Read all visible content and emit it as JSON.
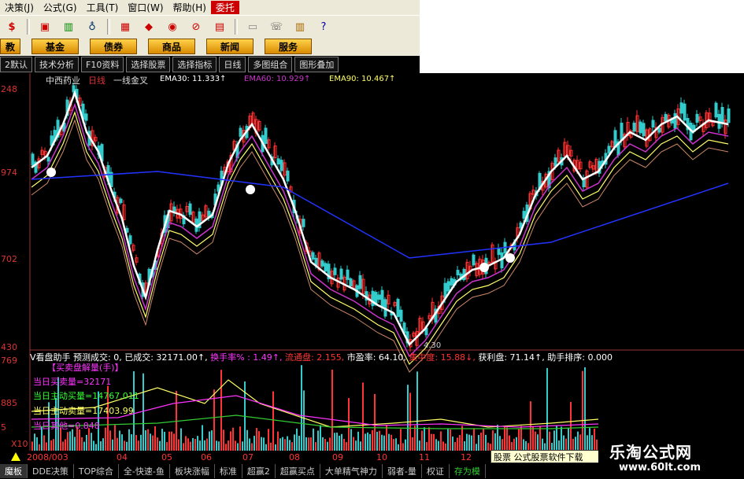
{
  "menu": {
    "items": [
      "决策(J)",
      "公式(G)",
      "工具(T)",
      "窗口(W)",
      "帮助(H)",
      "委托"
    ]
  },
  "nav": {
    "buttons": [
      "教",
      "基金",
      "债券",
      "商品",
      "新闻",
      "服务"
    ]
  },
  "toolbar2": {
    "items": [
      "2默认",
      "技术分析",
      "F10资料",
      "选择股票",
      "选择指标",
      "日线",
      "多图组合",
      "图形叠加"
    ]
  },
  "chart_header": {
    "stock": "中西药业",
    "period": "日线",
    "pattern": "一线金叉",
    "ema30": "EMA30: 11.333↑",
    "ema60": "EMA60: 10.929↑",
    "ema90": "EMA90: 10.467↑"
  },
  "yaxis": {
    "top": "248",
    "mid1": "974",
    "mid2": "702",
    "bottom": "430"
  },
  "low_marker": "4.30",
  "info_bar": {
    "title": "V看盘助手",
    "forecast": "预测成交: 0,",
    "done": "已成交: 32171.00↑,",
    "turnover": "换手率% : 1.49↑,",
    "float": "流通盘: 2.155,",
    "pe": "市盈率: 64.10,",
    "focus": "集中度: 15.88↓,",
    "profit": "获利盘: 71.14↑,",
    "rank": "助手排序: 0.000"
  },
  "volume_panel": {
    "ylabel_top": "769",
    "ylabel_mid": "885",
    "ylabel_bottom": "5",
    "title": "【买卖盘解量(手)】",
    "today_vol": "当日买卖量=32171",
    "active_buy": "当日主动买量=14767.011",
    "active_sell": "当日主动卖量=17403.99",
    "other": "当日其他=0.848",
    "xlabel_prefix": "X10"
  },
  "dates": [
    "2008/003",
    "04",
    "05",
    "06",
    "07",
    "08",
    "09",
    "10",
    "11",
    "12"
  ],
  "bottom_tabs": [
    "魔板",
    "DDE决策",
    "TOP综合",
    "全-快速-鱼",
    "板块涨幅",
    "标准",
    "超赢2",
    "超赢买点",
    "大单精气神力",
    "弱者-量",
    "权证",
    "存为模"
  ],
  "tooltip": "股票 公式股票软件下载",
  "brand": {
    "title": "乐淘公式网",
    "url": "www.60lt.com"
  },
  "colors": {
    "up": "#ff3333",
    "down": "#33cccc",
    "ema30": "#ffffff",
    "ema60": "#cc33cc",
    "ema90": "#ffff66",
    "long": "#2233ff"
  }
}
